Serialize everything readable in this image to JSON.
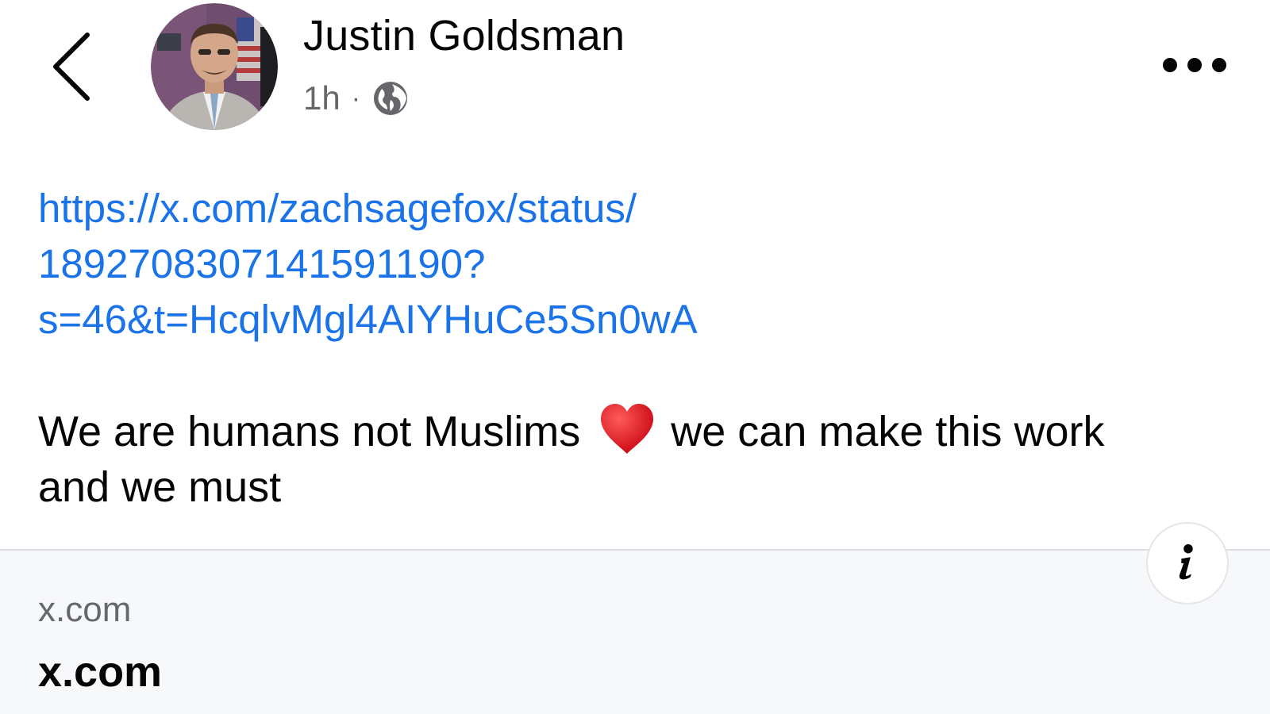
{
  "header": {
    "back_icon": "chevron-left-icon",
    "author_name": "Justin Goldsman",
    "timestamp": "1h",
    "separator": "·",
    "audience_icon": "globe-icon",
    "more_icon": "more-horizontal-icon"
  },
  "post": {
    "link_lines": [
      "https://x.com/zachsagefox/status/",
      "1892708307141591190?",
      "s=46&t=HcqlvMgl4AIYHuCe5Sn0wA"
    ],
    "text_part_1": "We are humans not Muslims",
    "emoji": "red-heart-emoji",
    "text_part_2": "we can make this work",
    "text_line_2": "and we must"
  },
  "link_preview": {
    "domain": "x.com",
    "title": "x.com",
    "info_icon": "info-icon"
  },
  "colors": {
    "link": "#1a73e8",
    "text": "#050505",
    "secondary_text": "#65676b",
    "card_background": "#f7f8fa",
    "heart": "#e0191b"
  }
}
